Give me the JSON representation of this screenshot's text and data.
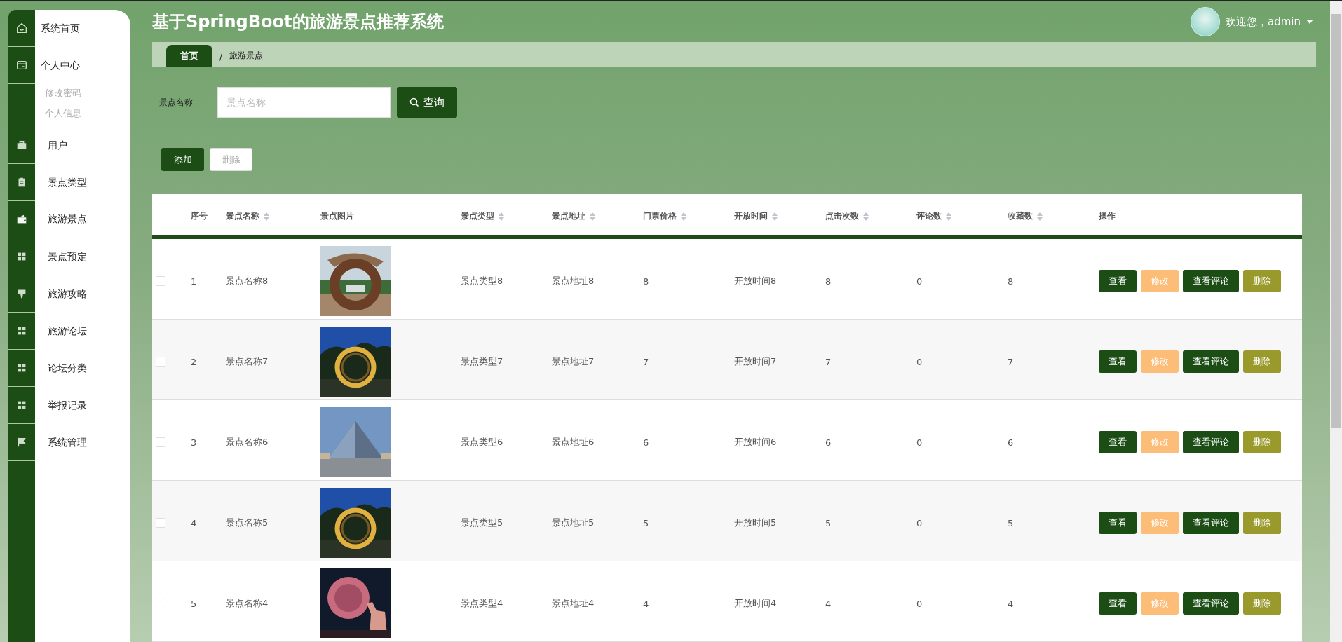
{
  "header": {
    "title": "基于SpringBoot的旅游景点推荐系统",
    "greeting": "欢迎您，admin"
  },
  "sidebar": {
    "items": [
      {
        "label": "系统首页",
        "selected": false
      },
      {
        "label": "个人中心",
        "selected": false,
        "children": [
          {
            "label": "修改密码"
          },
          {
            "label": "个人信息"
          }
        ]
      },
      {
        "label": "用户",
        "selected": false
      },
      {
        "label": "景点类型",
        "selected": false
      },
      {
        "label": "旅游景点",
        "selected": true
      },
      {
        "label": "景点预定",
        "selected": false
      },
      {
        "label": "旅游攻略",
        "selected": false
      },
      {
        "label": "旅游论坛",
        "selected": false
      },
      {
        "label": "论坛分类",
        "selected": false
      },
      {
        "label": "举报记录",
        "selected": false
      },
      {
        "label": "系统管理",
        "selected": false
      }
    ]
  },
  "breadcrumb": {
    "items": [
      "首页",
      "旅游景点"
    ],
    "separator": "/"
  },
  "search": {
    "label": "景点名称",
    "placeholder": "景点名称",
    "button": "查询"
  },
  "actions": [
    {
      "label": "添加",
      "kind": "primary"
    },
    {
      "label": "删除",
      "kind": "plain"
    }
  ],
  "table": {
    "select_all_checked": false,
    "columns": [
      {
        "label": "序号",
        "kind": "plain"
      },
      {
        "label": "景点名称",
        "kind": "sortable"
      },
      {
        "label": "景点图片",
        "kind": "plain"
      },
      {
        "label": "景点类型",
        "kind": "sortable"
      },
      {
        "label": "景点地址",
        "kind": "sortable"
      },
      {
        "label": "门票价格",
        "kind": "sortable"
      },
      {
        "label": "开放时间",
        "kind": "sortable"
      },
      {
        "label": "点击次数",
        "kind": "sortable"
      },
      {
        "label": "评论数",
        "kind": "sortable"
      },
      {
        "label": "收藏数",
        "kind": "sortable"
      },
      {
        "label": "操作",
        "kind": "plain"
      }
    ],
    "rows": [
      {
        "checked": false,
        "index": "1",
        "name": "景点名称8",
        "type": "景点类型8",
        "address": "景点地址8",
        "price": "8",
        "open_time": "开放时间8",
        "clicks": "8",
        "comments": "0",
        "favorites": "8",
        "actions": [
          {
            "label": "查看",
            "kind": "view"
          },
          {
            "label": "修改",
            "kind": "edit"
          },
          {
            "label": "查看评论",
            "kind": "comments"
          },
          {
            "label": "删除",
            "kind": "delete"
          }
        ]
      },
      {
        "checked": false,
        "index": "2",
        "name": "景点名称7",
        "type": "景点类型7",
        "address": "景点地址7",
        "price": "7",
        "open_time": "开放时间7",
        "clicks": "7",
        "comments": "0",
        "favorites": "7",
        "actions": [
          {
            "label": "查看",
            "kind": "view"
          },
          {
            "label": "修改",
            "kind": "edit"
          },
          {
            "label": "查看评论",
            "kind": "comments"
          },
          {
            "label": "删除",
            "kind": "delete"
          }
        ]
      },
      {
        "checked": false,
        "index": "3",
        "name": "景点名称6",
        "type": "景点类型6",
        "address": "景点地址6",
        "price": "6",
        "open_time": "开放时间6",
        "clicks": "6",
        "comments": "0",
        "favorites": "6",
        "actions": [
          {
            "label": "查看",
            "kind": "view"
          },
          {
            "label": "修改",
            "kind": "edit"
          },
          {
            "label": "查看评论",
            "kind": "comments"
          },
          {
            "label": "删除",
            "kind": "delete"
          }
        ]
      },
      {
        "checked": false,
        "index": "4",
        "name": "景点名称5",
        "type": "景点类型5",
        "address": "景点地址5",
        "price": "5",
        "open_time": "开放时间5",
        "clicks": "5",
        "comments": "0",
        "favorites": "5",
        "actions": [
          {
            "label": "查看",
            "kind": "view"
          },
          {
            "label": "修改",
            "kind": "edit"
          },
          {
            "label": "查看评论",
            "kind": "comments"
          },
          {
            "label": "删除",
            "kind": "delete"
          }
        ]
      },
      {
        "checked": false,
        "index": "5",
        "name": "景点名称4",
        "type": "景点类型4",
        "address": "景点地址4",
        "price": "4",
        "open_time": "开放时间4",
        "clicks": "4",
        "comments": "0",
        "favorites": "4",
        "actions": [
          {
            "label": "查看",
            "kind": "view"
          },
          {
            "label": "修改",
            "kind": "edit"
          },
          {
            "label": "查看评论",
            "kind": "comments"
          },
          {
            "label": "删除",
            "kind": "delete"
          }
        ]
      }
    ]
  }
}
